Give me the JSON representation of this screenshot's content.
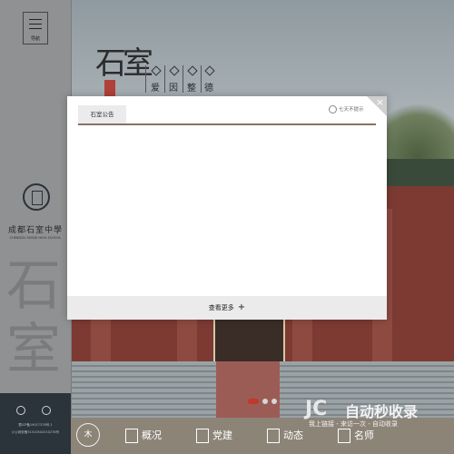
{
  "sidebar": {
    "menu_label": "导航",
    "school_name_cn": "成都石室中學",
    "school_name_en": "CHENGDU SHISHI HIGH SCHOOL",
    "brush_text": "石室",
    "footer_lines": [
      "蜀ICP备19017378号-1",
      "川公网安备51010502010278号"
    ]
  },
  "banner": {
    "calligraphy": "石室",
    "motto": [
      "爱",
      "因",
      "整",
      "德"
    ]
  },
  "modal": {
    "tab_label": "石室公告",
    "no_show_label": "七天不提示",
    "close_icon": "×",
    "more_label": "查看更多",
    "more_icon": "+"
  },
  "slider": {
    "count": 3,
    "active_index": 0
  },
  "bottom_nav": {
    "home_label": "木",
    "items": [
      {
        "label": "概况"
      },
      {
        "label": "党建"
      },
      {
        "label": "动态"
      },
      {
        "label": "名师"
      }
    ]
  },
  "watermark": {
    "logo": "JC",
    "title": "自动秒收录",
    "subtitle": "我上链接 - 来访一次 - 自动收录"
  },
  "colors": {
    "accent": "#8b6f62",
    "modal_bg": "#ffffff",
    "sidebar_footer": "#2b333b",
    "active_dot": "#c0392b"
  }
}
